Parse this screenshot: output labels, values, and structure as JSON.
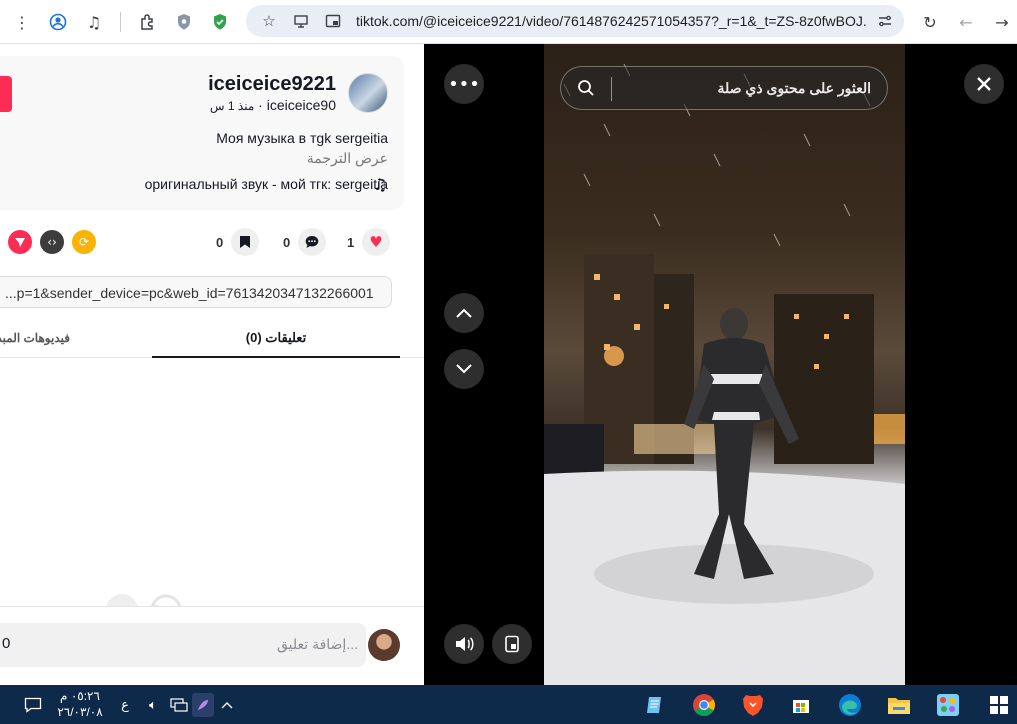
{
  "browser": {
    "url": "tiktok.com/@iceiceice9221/video/7614876242571054357?_r=1&_t=ZS-8z0fwBOJ...",
    "icons": [
      "menu-icon",
      "account-icon",
      "media-controls-icon",
      "extensions-icon",
      "shield-extension-icon",
      "vpn-extension-icon",
      "bookmark-star-icon",
      "cast-icon",
      "picture-in-picture-icon",
      "site-settings-icon",
      "reload-icon",
      "back-icon",
      "forward-icon"
    ]
  },
  "post": {
    "username": "iceiceice9221",
    "nickname": "iceiceice90",
    "posted": "منذ 1 س",
    "caption": "Моя музыка в тgk sergeitia",
    "see_translation": "عرض الترجمة",
    "sound": "оригинальный звук - мой тгк: sergeitia",
    "likes": "1",
    "comments": "0",
    "saves": "0",
    "link": "...p=1&sender_device=pc&web_id=7613420347132266001"
  },
  "tabs": {
    "comments": "تعليقات (0)",
    "creator_videos": "فيديوهات المبدع"
  },
  "comment_box": {
    "placeholder": "إضافة تعليق...",
    "count": "0"
  },
  "player": {
    "search_placeholder": "العثور على محتوى ذي صلة"
  },
  "taskbar": {
    "time": "٠٥:٢٦ م",
    "date": "٢٦/٠٣/٠٨",
    "lang": "ع",
    "apps": [
      "notepad-icon",
      "chrome-icon",
      "brave-icon",
      "store-icon",
      "edge-icon",
      "file-explorer-icon",
      "paint-icon",
      "windows-start-icon"
    ]
  },
  "colors": {
    "accent": "#fe2c55",
    "taskbar": "#0d2a4a",
    "omnibox": "#e9eef6"
  }
}
